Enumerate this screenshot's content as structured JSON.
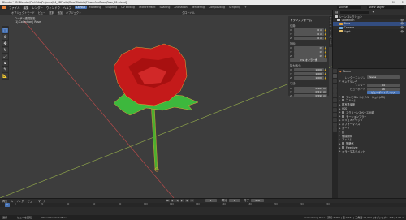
{
  "window": {
    "title": "Blender* [D:\\Blender\\Portfolio\\Projects\\04_3DFruits\\Rose\\Models\\FlowerAndRose\\Rose_01.blend]",
    "minimize": "—",
    "maximize": "☐",
    "close": "✕"
  },
  "menu": {
    "items": [
      "ファイル",
      "編集",
      "レンダー",
      "ウィンドウ",
      "ヘルプ"
    ],
    "workspaces": [
      "Layout",
      "Modeling",
      "Sculpting",
      "UV Editing",
      "Texture Paint",
      "Shading",
      "Animation",
      "Rendering",
      "Compositing",
      "Scripting",
      "+"
    ],
    "active_workspace": "Layout",
    "scene": "Scene",
    "view_layer": "View Layer"
  },
  "viewport": {
    "header_items": [
      "オブジェクトモード",
      "ビュー",
      "選択",
      "追加",
      "オブジェクト"
    ],
    "info_line1": "ユーザー透視投影",
    "info_line2": "(1) Collection | Rose",
    "shading": "グローバル",
    "colors": {
      "background": "#3d3d3d",
      "grid_x": "#b34a4a",
      "grid_y": "#8da34a",
      "outline": "#e8a33a",
      "petal": "#c41a1a",
      "leaf": "#3db83d",
      "stem": "#4caf2f"
    }
  },
  "npanel": {
    "title": "トランスフォーム",
    "location_label": "位置:",
    "location": [
      {
        "axis": "X",
        "value": "0 m"
      },
      {
        "axis": "Y",
        "value": "0 m"
      },
      {
        "axis": "Z",
        "value": "0 m"
      }
    ],
    "rotation_label": "回転:",
    "rotation": [
      {
        "axis": "X",
        "value": "0°"
      },
      {
        "axis": "Y",
        "value": "0°"
      },
      {
        "axis": "Z",
        "value": "0°"
      }
    ],
    "mode": "XYZ オイラー角",
    "scale_label": "拡大縮小:",
    "scale": [
      {
        "axis": "X",
        "value": "1.000"
      },
      {
        "axis": "Y",
        "value": "1.000"
      },
      {
        "axis": "Z",
        "value": "1.000"
      }
    ],
    "dimensions_label": "寸法:",
    "dimensions": [
      {
        "axis": "X",
        "value": "0.482 m"
      },
      {
        "axis": "Y",
        "value": "0.513 m"
      },
      {
        "axis": "Z",
        "value": "0.598 m"
      }
    ],
    "side_tabs": [
      "アイテム",
      "ツール",
      "ビュー"
    ]
  },
  "outliner": {
    "rows": [
      {
        "name": "シーンコレクション",
        "color": "#cccccc"
      },
      {
        "name": "Collection",
        "color": "#cccccc"
      },
      {
        "name": "Rose",
        "color": "#e8a33a"
      },
      {
        "name": "Camera",
        "color": "#6fa8dc"
      },
      {
        "name": "Light",
        "color": "#e8c36f"
      }
    ]
  },
  "properties": {
    "header": "Scene",
    "render_engine_label": "レンダーエンジン",
    "render_engine": "Eevee",
    "sampling": "サンプリング",
    "render": "レンダー",
    "render_value": "64",
    "viewport": "ビューポート",
    "viewport_value": "16",
    "view_transform_tabs": [
      "ビューポートデノイズ"
    ],
    "sections": [
      {
        "label": "アンビエントオクルージョン(AO)",
        "checkbox": true,
        "on": false
      },
      {
        "label": "ブルーム",
        "checkbox": true,
        "on": false
      },
      {
        "label": "被写界深度",
        "checkbox": false,
        "on": false
      },
      {
        "label": "SSS",
        "checkbox": false,
        "on": false
      },
      {
        "label": "スクリーンスペース反射",
        "checkbox": true,
        "on": false
      },
      {
        "label": "モーションブラー",
        "checkbox": true,
        "on": false
      },
      {
        "label": "ボリュメトリック",
        "checkbox": false,
        "on": false
      },
      {
        "label": "パフォーマンス",
        "checkbox": false,
        "on": false
      },
      {
        "label": "カーブ",
        "checkbox": false,
        "on": false
      },
      {
        "label": "影",
        "checkbox": false,
        "on": false
      },
      {
        "label": "間接照明",
        "checkbox": false,
        "on": false
      },
      {
        "label": "フィルム",
        "checkbox": false,
        "on": false
      },
      {
        "label": "簡略化",
        "checkbox": true,
        "on": false
      },
      {
        "label": "Freestyle",
        "checkbox": true,
        "on": false
      },
      {
        "label": "カラーマネジメント",
        "checkbox": false,
        "on": false
      }
    ]
  },
  "timeline": {
    "header_items": [
      "再生",
      "キーイング",
      "ビュー",
      "マーカー"
    ],
    "current_frame": "1",
    "start_label": "開始",
    "start": "1",
    "end_label": "終了",
    "end": "250",
    "ticks": [
      "0",
      "20",
      "40",
      "60",
      "80",
      "100",
      "120",
      "140",
      "160",
      "180",
      "200",
      "220",
      "240"
    ]
  },
  "status": {
    "select": "選択",
    "pan": "ビューを回転",
    "context": "Object Context Menu",
    "info": "Collection | Rose | 頂点:7,468 | 面:7,152 | 三角面:14,304 | オブジェクト:1/3 | 2.90.1"
  }
}
